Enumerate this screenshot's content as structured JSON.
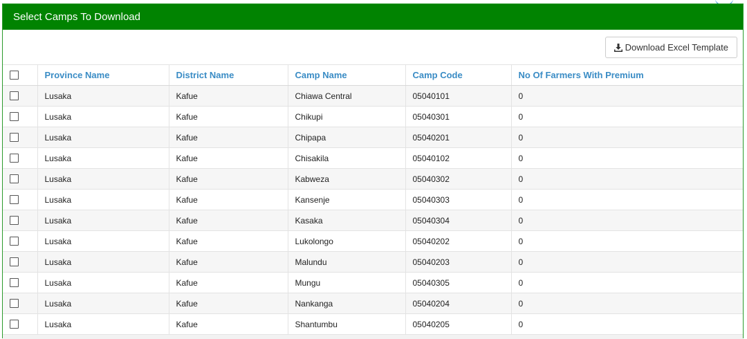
{
  "panel": {
    "title": "Select Camps To Download",
    "header_color": "#018301"
  },
  "toolbar": {
    "download_label": "Download Excel Template",
    "download_icon": "download-icon"
  },
  "table": {
    "columns": [
      "Province Name",
      "District Name",
      "Camp Name",
      "Camp Code",
      "No Of Farmers With Premium"
    ],
    "header_color": "#3a8cc5",
    "rows": [
      [
        "Lusaka",
        "Kafue",
        "Chiawa Central",
        "05040101",
        "0"
      ],
      [
        "Lusaka",
        "Kafue",
        "Chikupi",
        "05040301",
        "0"
      ],
      [
        "Lusaka",
        "Kafue",
        "Chipapa",
        "05040201",
        "0"
      ],
      [
        "Lusaka",
        "Kafue",
        "Chisakila",
        "05040102",
        "0"
      ],
      [
        "Lusaka",
        "Kafue",
        "Kabweza",
        "05040302",
        "0"
      ],
      [
        "Lusaka",
        "Kafue",
        "Kansenje",
        "05040303",
        "0"
      ],
      [
        "Lusaka",
        "Kafue",
        "Kasaka",
        "05040304",
        "0"
      ],
      [
        "Lusaka",
        "Kafue",
        "Lukolongo",
        "05040202",
        "0"
      ],
      [
        "Lusaka",
        "Kafue",
        "Malundu",
        "05040203",
        "0"
      ],
      [
        "Lusaka",
        "Kafue",
        "Mungu",
        "05040305",
        "0"
      ],
      [
        "Lusaka",
        "Kafue",
        "Nankanga",
        "05040204",
        "0"
      ],
      [
        "Lusaka",
        "Kafue",
        "Shantumbu",
        "05040205",
        "0"
      ]
    ]
  }
}
